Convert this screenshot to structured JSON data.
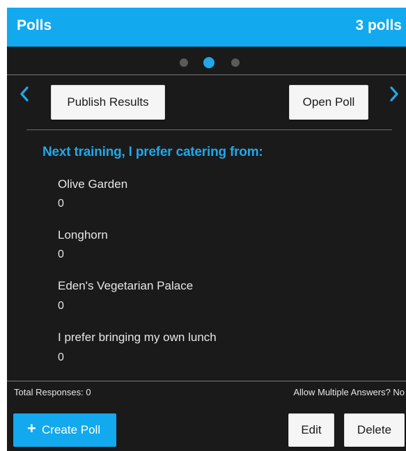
{
  "header": {
    "title": "Polls",
    "count": "3 polls"
  },
  "pager": {
    "total": 3,
    "active_index": 1
  },
  "actions": {
    "publish_label": "Publish Results",
    "open_label": "Open Poll"
  },
  "poll": {
    "question": "Next training, I prefer catering from:",
    "options": [
      {
        "label": "Olive Garden",
        "count": "0"
      },
      {
        "label": "Longhorn",
        "count": "0"
      },
      {
        "label": "Eden's Vegetarian Palace",
        "count": "0"
      },
      {
        "label": "I prefer bringing my own lunch",
        "count": "0"
      }
    ]
  },
  "footer": {
    "total_responses": "Total Responses: 0",
    "allow_multiple": "Allow Multiple Answers? No",
    "create_label": "Create Poll",
    "edit_label": "Edit",
    "delete_label": "Delete"
  },
  "colors": {
    "accent": "#12a9ee",
    "panel_bg": "#1a1a1a"
  },
  "icons": {
    "prev": "chevron-left-icon",
    "next": "chevron-right-icon",
    "create": "plus-icon"
  }
}
